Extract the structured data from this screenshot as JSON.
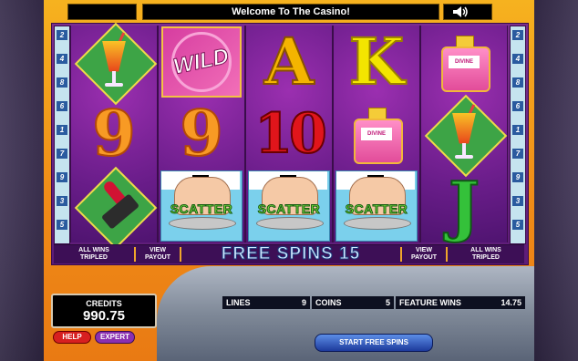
{
  "header": {
    "title": "Welcome To The Casino!",
    "sound_icon": "speaker-icon"
  },
  "line_markers": {
    "left": [
      "2",
      "4",
      "8",
      "6",
      "1",
      "7",
      "9",
      "3",
      "5"
    ],
    "right": [
      "2",
      "4",
      "8",
      "6",
      "1",
      "7",
      "9",
      "3",
      "5"
    ]
  },
  "reels": [
    [
      "cocktail",
      "9",
      "lipstick"
    ],
    [
      "WILD",
      "9",
      "SCATTER"
    ],
    [
      "A",
      "10",
      "SCATTER"
    ],
    [
      "K",
      "DIVINE",
      "SCATTER"
    ],
    [
      "DIVINE",
      "cocktail",
      "J"
    ]
  ],
  "symbols": {
    "wild": "WILD",
    "scatter": "SCATTER",
    "perfume_label": "DIVINE",
    "nine": "9",
    "ten": "10",
    "a": "A",
    "k": "K",
    "j": "J"
  },
  "banner": {
    "left_note_line1": "ALL WINS",
    "left_note_line2": "TRIPLED",
    "left_payout_line1": "VIEW",
    "left_payout_line2": "PAYOUT",
    "free_spins": "FREE SPINS 15",
    "right_payout_line1": "VIEW",
    "right_payout_line2": "PAYOUT",
    "right_note_line1": "ALL WINS",
    "right_note_line2": "TRIPLED"
  },
  "credits": {
    "label": "CREDITS",
    "value": "990.75"
  },
  "buttons": {
    "help": "HELP",
    "expert": "EXPERT",
    "start": "START FREE SPINS"
  },
  "stats": {
    "lines_label": "LINES",
    "lines_value": "9",
    "coins_label": "COINS",
    "coins_value": "5",
    "feature_label": "FEATURE WINS",
    "feature_value": "14.75"
  },
  "colors": {
    "frame": "#f08c17",
    "reel_bg": "#6a1d8a",
    "banner_bg": "#3d0f56"
  }
}
